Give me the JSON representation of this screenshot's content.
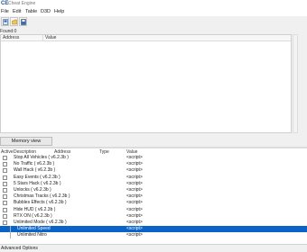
{
  "window": {
    "title": "Cheat Engine",
    "logo_text": "CE"
  },
  "menu": [
    "File",
    "Edit",
    "Table",
    "D3D",
    "Help"
  ],
  "toolbar": {
    "buttons": [
      "open-process-icon",
      "open-file-icon",
      "save-icon"
    ]
  },
  "scan_results": {
    "found_label": "Found:0",
    "columns": [
      "Address",
      "Value"
    ]
  },
  "memory_view_button": "Memory view",
  "cheat_table": {
    "columns": [
      "Active",
      "Description",
      "Address",
      "Type",
      "Value"
    ],
    "rows": [
      {
        "description": "Stop All Vehicles ( v6.2.3b )",
        "value": "<script>",
        "child": false,
        "selected": false
      },
      {
        "description": "No Traffic ( v6.2.3b )",
        "value": "<script>",
        "child": false,
        "selected": false
      },
      {
        "description": "Wall Hack ( v6.2.3b )",
        "value": "<script>",
        "child": false,
        "selected": false
      },
      {
        "description": "Easy Events ( v6.2.3b )",
        "value": "<script>",
        "child": false,
        "selected": false
      },
      {
        "description": "5 Stars Hack ( v6.2.3b )",
        "value": "<script>",
        "child": false,
        "selected": false
      },
      {
        "description": "Unlocks ( v6.2.3b )",
        "value": "<script>",
        "child": false,
        "selected": false
      },
      {
        "description": "Christmas Tracks ( v6.2.3b )",
        "value": "<script>",
        "child": false,
        "selected": false
      },
      {
        "description": "Bubbles Effects ( v6.2.3b )",
        "value": "<script>",
        "child": false,
        "selected": false
      },
      {
        "description": "Hide HUD ( v6.2.3b )",
        "value": "<script>",
        "child": false,
        "selected": false
      },
      {
        "description": "RTX ON ( v6.2.3b )",
        "value": "<script>",
        "child": false,
        "selected": false
      },
      {
        "description": "Unlimited Mode ( v6.2.3b )",
        "value": "<script>",
        "child": false,
        "selected": false
      },
      {
        "description": "Unlimited Speed",
        "value": "<script>",
        "child": true,
        "selected": true
      },
      {
        "description": "Unlimited Nitro",
        "value": "<script>",
        "child": true,
        "selected": false
      }
    ]
  },
  "footer": {
    "label": "Advanced Options"
  },
  "colors": {
    "selection": "#0a64c8",
    "logo": "#1d4f91"
  }
}
